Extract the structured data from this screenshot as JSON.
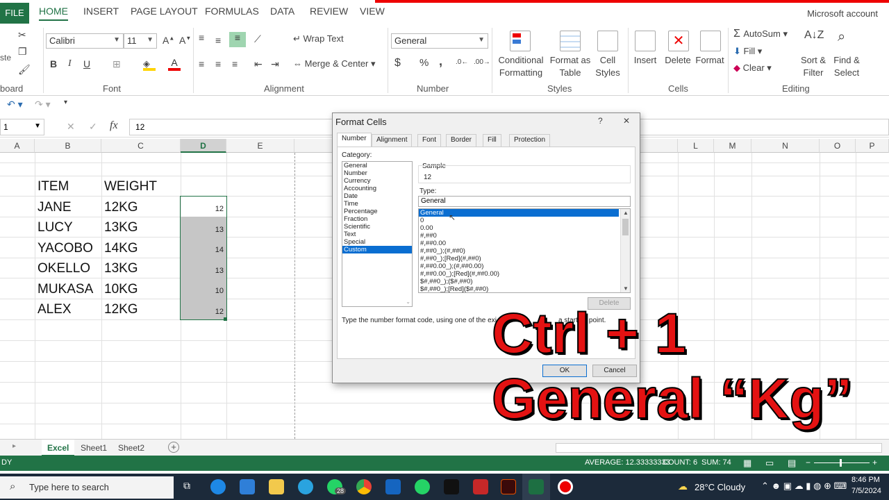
{
  "ribbon": {
    "file_tab": "FILE",
    "tabs": [
      "HOME",
      "INSERT",
      "PAGE LAYOUT",
      "FORMULAS",
      "DATA",
      "REVIEW",
      "VIEW"
    ],
    "account": "Microsoft account",
    "groups": {
      "clipboard": "board",
      "clipboard_paste": "ste",
      "font": "Font",
      "alignment": "Alignment",
      "number": "Number",
      "styles": "Styles",
      "cells": "Cells",
      "editing": "Editing"
    },
    "font_name": "Calibri",
    "font_size": "11",
    "wrap_text": "Wrap Text",
    "merge_center": "Merge & Center",
    "number_format": "General",
    "conditional_formatting": "Conditional Formatting",
    "format_as_table": "Format as Table",
    "cell_styles": "Cell Styles",
    "insert": "Insert",
    "delete": "Delete",
    "format": "Format",
    "autosum": "AutoSum",
    "fill": "Fill",
    "clear": "Clear",
    "sort_filter": "Sort & Filter",
    "find_select": "Find & Select",
    "bold": "B",
    "italic": "I",
    "underline": "U",
    "currency_symbol": "$",
    "percent_symbol": "%",
    "comma_symbol": ","
  },
  "formula_bar": {
    "name_box": "1",
    "fx": "fx",
    "value": "12"
  },
  "grid": {
    "columns": [
      "A",
      "B",
      "C",
      "D",
      "E",
      "L",
      "M",
      "N",
      "O",
      "P"
    ],
    "selected_column": "D",
    "headers": {
      "item": "ITEM",
      "weight": "WEIGHT"
    },
    "rows": [
      {
        "item": "JANE",
        "weight": "12KG",
        "d": "12"
      },
      {
        "item": "LUCY",
        "weight": "13KG",
        "d": "13"
      },
      {
        "item": "YACOBO",
        "weight": "14KG",
        "d": "14"
      },
      {
        "item": "OKELLO",
        "weight": "13KG",
        "d": "13"
      },
      {
        "item": "MUKASA",
        "weight": "10KG",
        "d": "10"
      },
      {
        "item": "ALEX",
        "weight": "12KG",
        "d": "12"
      }
    ]
  },
  "sheets": {
    "tabs": [
      "Excel",
      "Sheet1",
      "Sheet2"
    ],
    "active": "Excel",
    "add": "+"
  },
  "status": {
    "left": "DY",
    "average": "AVERAGE: 12.33333333",
    "count": "COUNT: 6",
    "sum": "SUM: 74"
  },
  "dialog": {
    "title": "Format Cells",
    "help": "?",
    "close": "✕",
    "tabs": [
      "Number",
      "Alignment",
      "Font",
      "Border",
      "Fill",
      "Protection"
    ],
    "active_tab": "Number",
    "category_label": "Category:",
    "categories": [
      "General",
      "Number",
      "Currency",
      "Accounting",
      "Date",
      "Time",
      "Percentage",
      "Fraction",
      "Scientific",
      "Text",
      "Special",
      "Custom"
    ],
    "selected_category": "Custom",
    "sample_label": "Sample",
    "sample_value": "12",
    "type_label": "Type:",
    "type_value": "General",
    "types": [
      "General",
      "0",
      "0.00",
      "#,##0",
      "#,##0.00",
      "#,##0_);(#,##0)",
      "#,##0_);[Red](#,##0)",
      "#,##0.00_);(#,##0.00)",
      "#,##0.00_);[Red](#,##0.00)",
      "$#,##0_);($#,##0)",
      "$#,##0_);[Red]($#,##0)"
    ],
    "selected_type": "General",
    "delete_btn": "Delete",
    "hint": "Type the number format code, using one of the exi",
    "hint_tail": "a starting point.",
    "ok": "OK",
    "cancel": "Cancel"
  },
  "caption": {
    "line1": "Ctrl + 1",
    "line2": "General “Kg”"
  },
  "taskbar": {
    "search_placeholder": "Type here to search",
    "badge": "28",
    "weather": "28°C  Cloudy",
    "time": "8:46 PM",
    "date": "7/5/2024"
  }
}
